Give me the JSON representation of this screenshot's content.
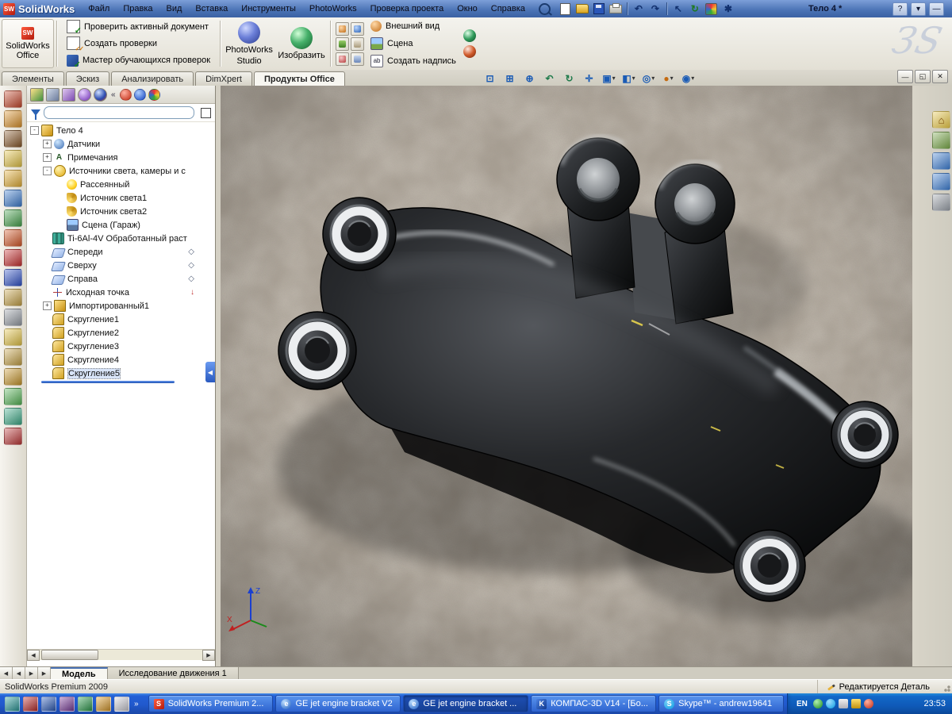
{
  "titlebar": {
    "app": "SolidWorks",
    "doc_title": "Тело 4 *"
  },
  "menu": {
    "items": [
      "Файл",
      "Правка",
      "Вид",
      "Вставка",
      "Инструменты",
      "PhotoWorks",
      "Проверка проекта",
      "Окно",
      "Справка"
    ]
  },
  "commandbar": {
    "office": {
      "line1": "SolidWorks",
      "line2": "Office"
    },
    "verify": [
      "Проверить активный документ",
      "Создать проверки",
      "Мастер обучающихся проверок"
    ],
    "studio_l1": "PhotoWorks",
    "studio_l2": "Studio",
    "render": "Изобразить",
    "appearance": "Внешний вид",
    "scene": "Сцена",
    "caption": "Создать надпись",
    "watermark": "ЗS"
  },
  "cmd_tabs": {
    "items": [
      "Элементы",
      "Эскиз",
      "Анализировать",
      "DimXpert",
      "Продукты Office"
    ],
    "active": "Продукты Office"
  },
  "feature_tree": {
    "root": "Тело 4",
    "items": [
      "Датчики",
      "Примечания",
      "Источники света, камеры и с",
      "Рассеянный",
      "Источник света1",
      "Источник света2",
      "Сцена (Гараж)",
      "Ti-6Al-4V Обработанный раст",
      "Спереди",
      "Сверху",
      "Справа",
      "Исходная точка",
      "Импортированный1",
      "Скругление1",
      "Скругление2",
      "Скругление3",
      "Скругление4",
      "Скругление5"
    ],
    "selected": "Скругление5"
  },
  "viewport": {
    "toolbar": [
      {
        "name": "zoom-fit",
        "glyph": "⊡"
      },
      {
        "name": "zoom-area",
        "glyph": "⊞"
      },
      {
        "name": "zoom-in-out",
        "glyph": "⊕"
      },
      {
        "name": "previous-view",
        "glyph": "↶"
      },
      {
        "name": "rotate-view",
        "glyph": "↻"
      },
      {
        "name": "pan",
        "glyph": "✛"
      },
      {
        "name": "view-orientation",
        "glyph": "▣"
      },
      {
        "name": "display-style",
        "glyph": "◧"
      },
      {
        "name": "hide-show-items",
        "glyph": "◎"
      },
      {
        "name": "edit-appearance",
        "glyph": "●"
      },
      {
        "name": "apply-scene",
        "glyph": "◉"
      }
    ],
    "triad": {
      "x": "X",
      "z": "Z"
    }
  },
  "doc_tabs": {
    "items": [
      "Модель",
      "Исследование движения 1"
    ],
    "active": "Модель"
  },
  "statusbar": {
    "product": "SolidWorks Premium 2009",
    "mode": "Редактируется Деталь"
  },
  "taskbar": {
    "tasks": [
      {
        "icon": "S",
        "label": "SolidWorks Premium 2..."
      },
      {
        "icon": "e",
        "label": "GE jet engine bracket V2"
      },
      {
        "icon": "e",
        "label": "GE jet engine bracket ..."
      },
      {
        "icon": "K",
        "label": "КОМПАС-3D V14 - [Бо..."
      },
      {
        "icon": "S",
        "label": "Skype™ - andrew19641"
      }
    ],
    "tray": {
      "lang": "EN",
      "clock": "23:53"
    }
  },
  "symbols": {
    "plus": "+",
    "minus": "-",
    "caret": "▾",
    "collapse": "«",
    "overflow": "»",
    "prev": "◀",
    "next": "▶",
    "help": "?",
    "close": "✕",
    "minimize": "—",
    "restore": "◱",
    "undo": "↶",
    "redo": "↷",
    "pointer": "↖",
    "rebuild": "↻",
    "options": "✱",
    "diamond": "◇",
    "down": "↓",
    "home": "⌂"
  },
  "colors": {
    "taskbar_blue": "#2159cd",
    "selection_blue": "#316ac5",
    "concrete": "#a89f93",
    "rollback_blue": "#2b6bd8"
  }
}
